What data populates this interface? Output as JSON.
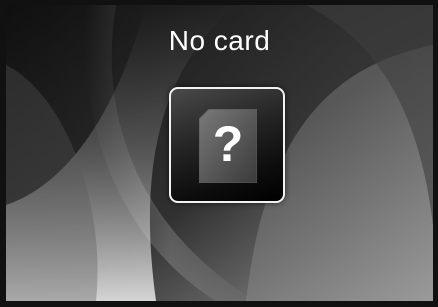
{
  "status": {
    "title": "No card"
  },
  "card_tile": {
    "icon": "sd-card-icon",
    "glyph": "?"
  },
  "colors": {
    "frame": "#111111",
    "background_dark": "#1c1c1c",
    "background_light": "#d8d8d8",
    "tile_border": "#f2f2f2",
    "text": "#ffffff"
  }
}
